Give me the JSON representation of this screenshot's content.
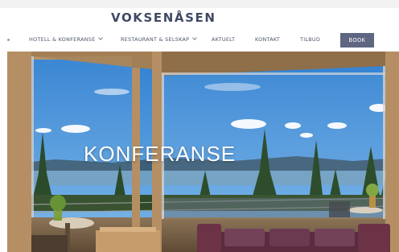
{
  "site": {
    "logo_text": "VOKSENÅSEN"
  },
  "nav": {
    "items": [
      {
        "label": "HOTELL & KONFERANSE",
        "has_dropdown": true
      },
      {
        "label": "RESTAURANT & SELSKAP",
        "has_dropdown": true
      },
      {
        "label": "AKTUELT",
        "has_dropdown": false
      },
      {
        "label": "KONTAKT",
        "has_dropdown": false
      },
      {
        "label": "TILBUD",
        "has_dropdown": false
      }
    ],
    "book_label": "BOOK",
    "book_color": "#5f6682"
  },
  "hero": {
    "title": "KONFERANSE"
  },
  "colors": {
    "logo": "#3f4a63",
    "nav_text": "#4a5368",
    "sky": "#3f8fd6",
    "window_frame": "#b58f63",
    "sofa": "#5a2c3d"
  }
}
